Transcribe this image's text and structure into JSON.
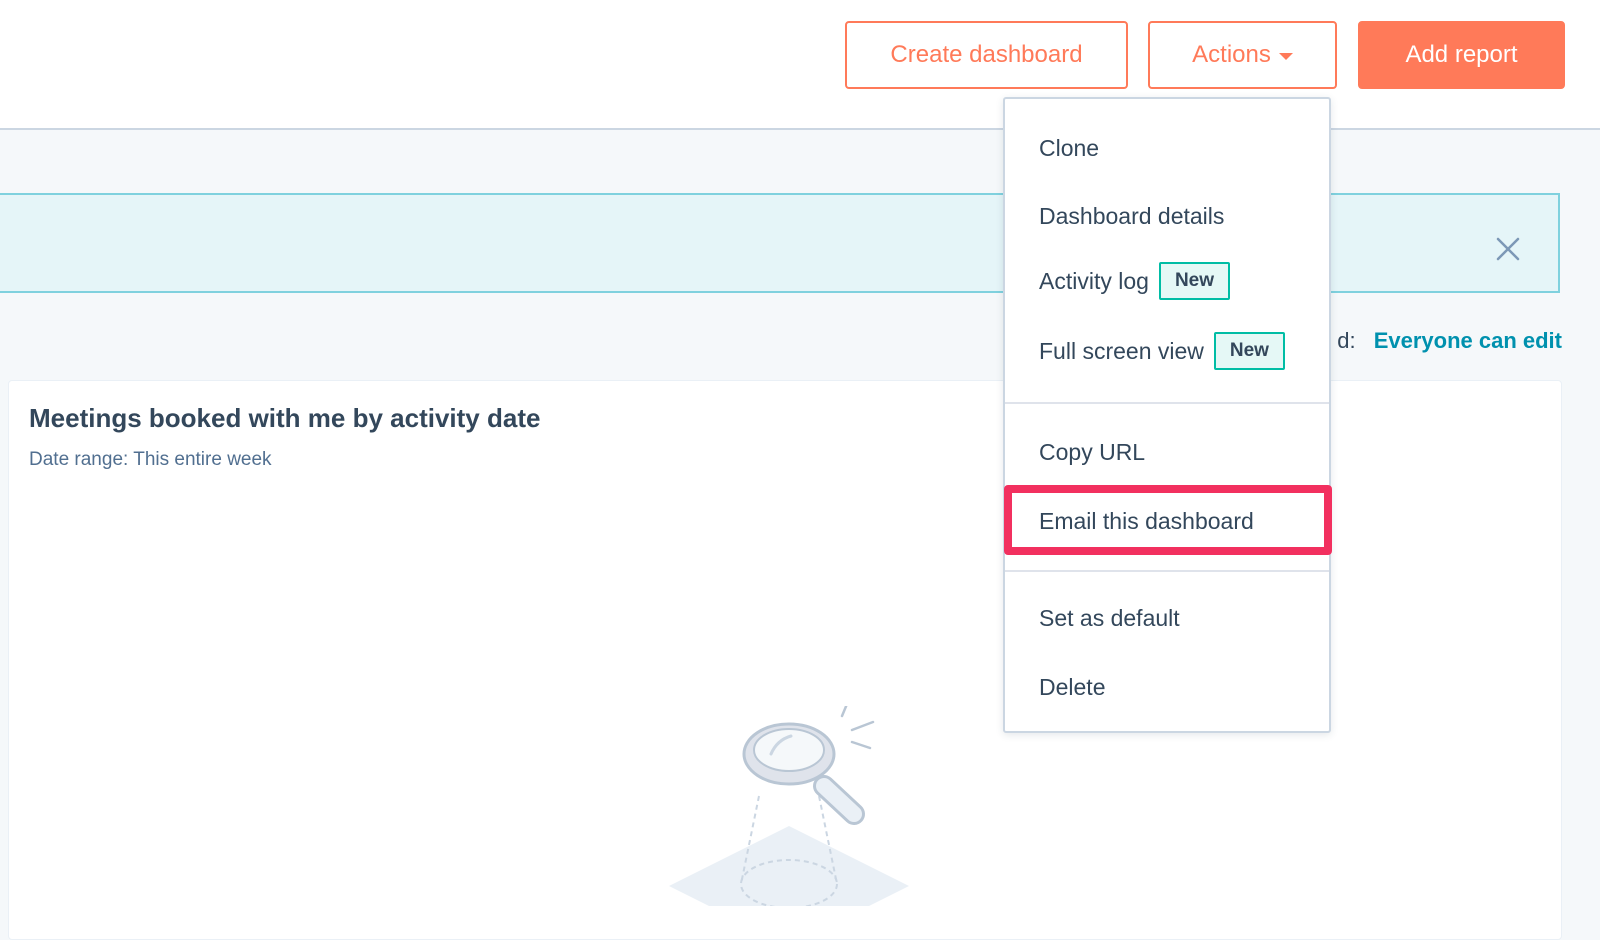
{
  "toolbar": {
    "create_dashboard_label": "Create dashboard",
    "actions_label": "Actions",
    "add_report_label": "Add report"
  },
  "alert": {
    "close_icon": "close-icon"
  },
  "sharing": {
    "label_fragment": "d:",
    "value": "Everyone can edit"
  },
  "report_card": {
    "title": "Meetings booked with me by activity date",
    "subtitle": "Date range: This entire week",
    "illustration_icon": "magnifier-empty-state-icon"
  },
  "actions_menu": {
    "items": [
      {
        "label": "Clone"
      },
      {
        "label": "Dashboard details"
      },
      {
        "label": "Activity log",
        "badge": "New"
      },
      {
        "label": "Full screen view",
        "badge": "New"
      },
      {
        "label": "Copy URL"
      },
      {
        "label": "Email this dashboard",
        "highlighted": true
      },
      {
        "label": "Set as default"
      },
      {
        "label": "Delete"
      }
    ]
  },
  "colors": {
    "accent": "#ff7a59",
    "link": "#0091ae",
    "text": "#33475b",
    "highlight": "#f2305f",
    "badge_border": "#00bda5"
  }
}
